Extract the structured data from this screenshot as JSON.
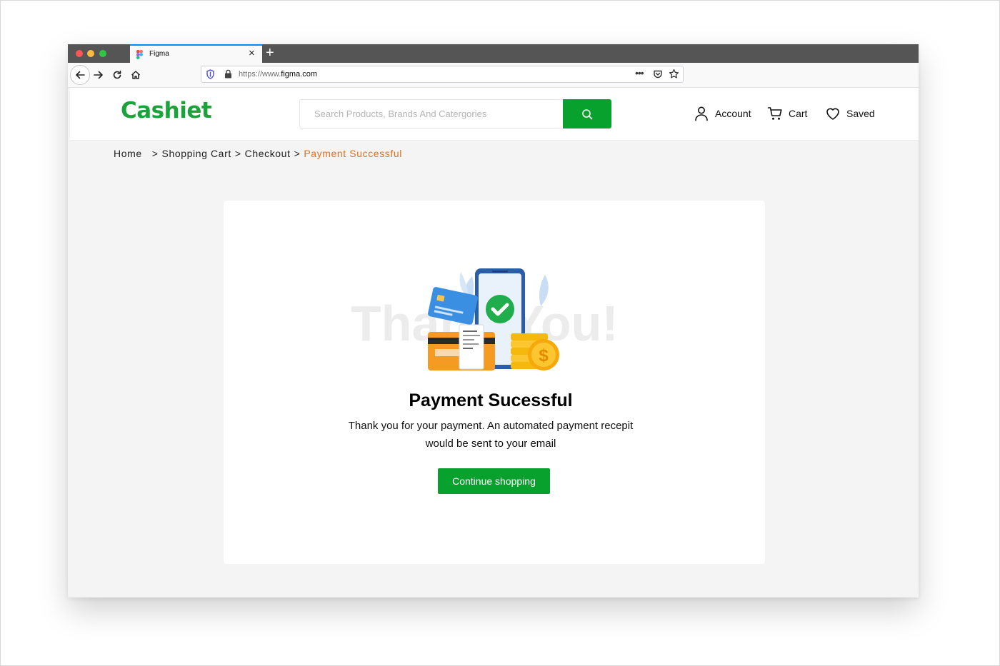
{
  "browser": {
    "tab_title": "Figma",
    "new_tab_symbol": "+",
    "close_symbol": "×",
    "url_prefix": "https://www.",
    "url_domain": "figma.com",
    "url_menu_symbol": "•••"
  },
  "header": {
    "logo": "Cashiet",
    "search_placeholder": "Search Products, Brands And Catergories",
    "account_label": "Account",
    "cart_label": "Cart",
    "saved_label": "Saved"
  },
  "breadcrumb": {
    "items": [
      "Home",
      "Shopping Cart",
      "Checkout"
    ],
    "separator": ">",
    "current": "Payment Successful"
  },
  "card": {
    "illustration_watermark": "Thank You!",
    "title": "Payment Sucessful",
    "message_line1": "Thank you for your payment. An automated payment recepit",
    "message_line2": "would be sent to your email",
    "button_label": "Continue shopping"
  },
  "colors": {
    "brand_green": "#09a12e",
    "breadcrumb_current": "#e2701c",
    "page_background": "#f4f4f4"
  },
  "icons": [
    "figma-favicon-icon",
    "back-arrow-icon",
    "forward-arrow-icon",
    "reload-icon",
    "home-icon",
    "tracking-shield-icon",
    "lock-icon",
    "pocket-icon",
    "bookmark-star-icon",
    "search-icon",
    "user-icon",
    "cart-icon",
    "heart-icon"
  ]
}
